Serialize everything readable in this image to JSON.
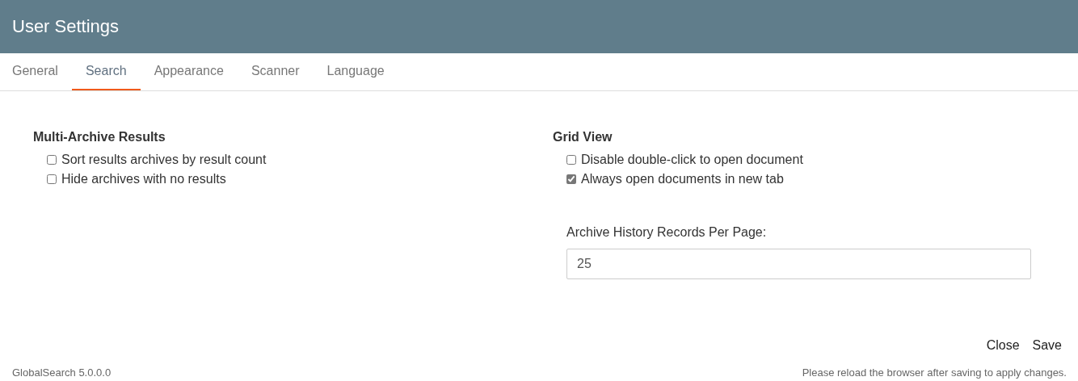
{
  "window": {
    "title": "User Settings"
  },
  "tabs": [
    {
      "label": "General",
      "selected": false
    },
    {
      "label": "Search",
      "selected": true
    },
    {
      "label": "Appearance",
      "selected": false
    },
    {
      "label": "Scanner",
      "selected": false
    },
    {
      "label": "Language",
      "selected": false
    }
  ],
  "sections": [
    {
      "title": "Multi-Archive Results",
      "options": [
        {
          "label": "Sort results archives by result count",
          "checked": false
        },
        {
          "label": "Hide archives with no results",
          "checked": false
        }
      ]
    },
    {
      "title": "Grid View",
      "options": [
        {
          "label": "Disable double-click to open document",
          "checked": false
        },
        {
          "label": "Always open documents in new tab",
          "checked": true
        }
      ],
      "field": {
        "label": "Archive History Records Per Page:",
        "value": "25"
      }
    }
  ],
  "buttons": [
    "Close",
    "Save"
  ],
  "footer": {
    "version": "GlobalSearch 5.0.0.0",
    "note": "Please reload the browser after saving to apply changes."
  }
}
